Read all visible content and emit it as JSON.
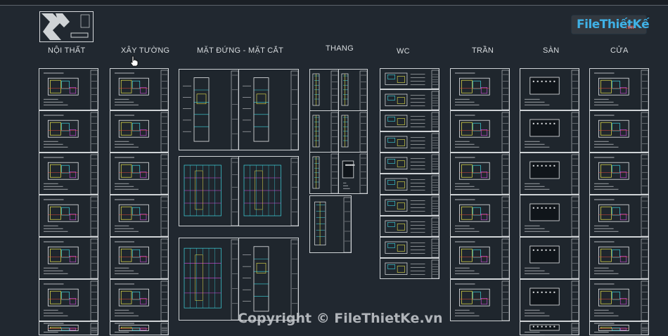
{
  "groups": [
    {
      "key": "noi-that",
      "label": "NỘI THẤT"
    },
    {
      "key": "xay-tuong",
      "label": "XÂY TƯỜNG"
    },
    {
      "key": "mat-dung",
      "label": "MẶT ĐỨNG - MẶT CẮT"
    },
    {
      "key": "thang",
      "label": "THANG"
    },
    {
      "key": "wc",
      "label": "WC"
    },
    {
      "key": "tran",
      "label": "TRẦN"
    },
    {
      "key": "san",
      "label": "SÀN"
    },
    {
      "key": "cua",
      "label": "CỬA"
    }
  ],
  "logo": {
    "text": "FileThiếtKế",
    "suffix": ".vn"
  },
  "watermark": "Copyright © FileThietKe.vn",
  "colors": {
    "background": "#212830",
    "sheet_border": "#cfd3d6",
    "cad_yellow": "#e8e34a",
    "cad_cyan": "#3fd6e0",
    "cad_red": "#e24a3a",
    "cad_magenta": "#d54ce0",
    "cad_blue": "#4a6cf0",
    "cad_white": "#e6e8ea",
    "logo_blue": "#3fb1e6"
  }
}
